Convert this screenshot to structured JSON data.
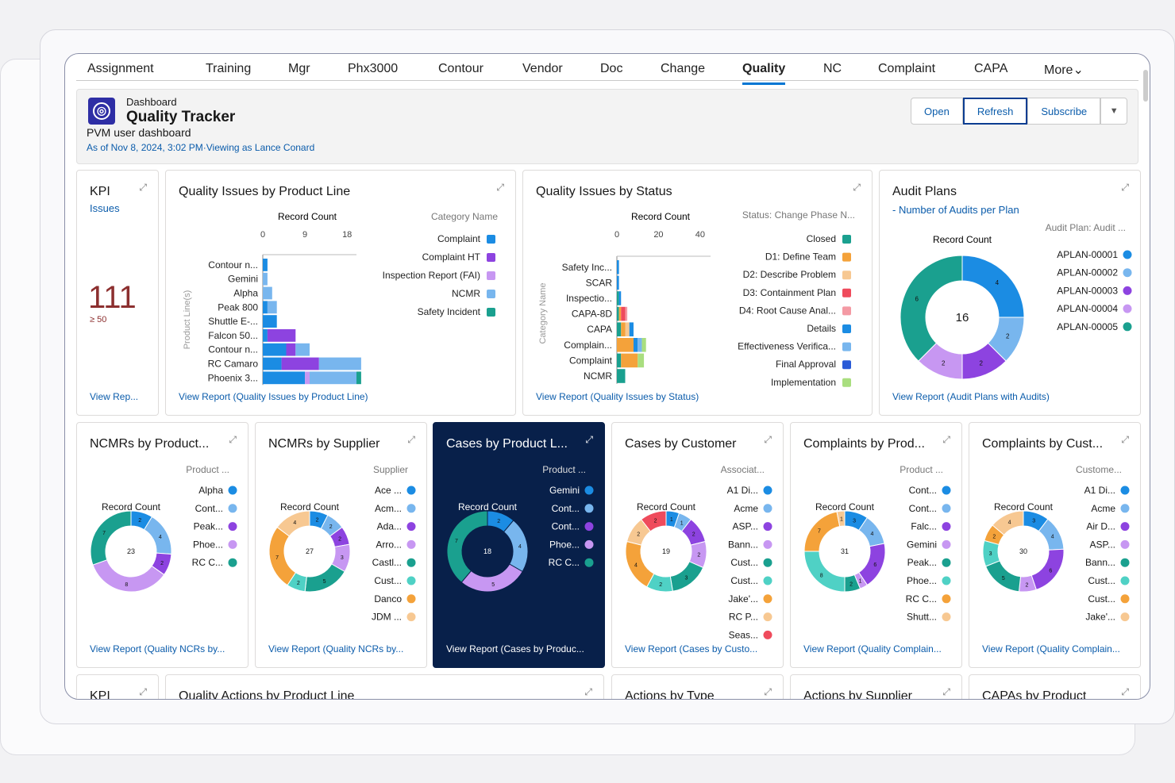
{
  "tabs": [
    "Assignment",
    "Training",
    "Mgr",
    "Phx3000",
    "Contour",
    "Vendor",
    "Doc",
    "Change",
    "Quality",
    "NC",
    "Complaint",
    "CAPA",
    "More"
  ],
  "active_tab": "Quality",
  "header": {
    "subtitle": "Dashboard",
    "title": "Quality Tracker",
    "description": "PVM user dashboard",
    "as_of": "As of Nov 8, 2024, 3:02 PM·Viewing as Lance Conard"
  },
  "buttons": {
    "open": "Open",
    "refresh": "Refresh",
    "subscribe": "Subscribe"
  },
  "kpi": {
    "title": "KPI",
    "subtitle": "Issues",
    "value": "111",
    "target": "≥ 50",
    "link": "View Rep..."
  },
  "qi_product": {
    "title": "Quality Issues by Product Line",
    "link": "View Report (Quality Issues by Product Line)",
    "xlabel": "Record Count",
    "ylabel": "Product Line(s)",
    "legend_title": "Category Name"
  },
  "qi_status": {
    "title": "Quality Issues by Status",
    "link": "View Report (Quality Issues by Status)",
    "xlabel": "Record Count",
    "ylabel": "Category Name",
    "legend_title": "Status: Change Phase N..."
  },
  "audit": {
    "title": "Audit Plans",
    "subtitle": "- Number of Audits per Plan",
    "link": "View Report (Audit Plans with Audits)",
    "count_label": "Record Count",
    "legend_title": "Audit Plan: Audit ..."
  },
  "donuts": [
    {
      "title": "NCMRs by Product...",
      "link": "View Report (Quality NCRs by...",
      "legend_title": "Product ...",
      "count_label": "Record Count"
    },
    {
      "title": "NCMRs by Supplier",
      "link": "View Report (Quality NCRs by...",
      "legend_title": "Supplier",
      "count_label": "Record Count"
    },
    {
      "title": "Cases by Product L...",
      "link": "View Report (Cases by Produc...",
      "legend_title": "Product ...",
      "count_label": "Record Count"
    },
    {
      "title": "Cases by Customer",
      "link": "View Report (Cases by Custo...",
      "legend_title": "Associat...",
      "count_label": "Record Count"
    },
    {
      "title": "Complaints by Prod...",
      "link": "View Report (Quality Complain...",
      "legend_title": "Product ...",
      "count_label": "Record Count"
    },
    {
      "title": "Complaints by Cust...",
      "link": "View Report (Quality Complain...",
      "legend_title": "Custome...",
      "count_label": "Record Count"
    }
  ],
  "row3": [
    {
      "title": "KPI"
    },
    {
      "title": "Quality Actions by Product Line"
    },
    {
      "title": "Actions by Type"
    },
    {
      "title": "Actions by Supplier"
    },
    {
      "title": "CAPAs by Product"
    }
  ],
  "chart_data": [
    {
      "type": "bar",
      "title": "Quality Issues by Product Line",
      "xlabel": "Record Count",
      "ylabel": "Product Line(s)",
      "xlim": [
        0,
        20
      ],
      "ticks": [
        "0",
        "9",
        "18"
      ],
      "categories": [
        "Contour n...",
        "Gemini",
        "Alpha",
        "Peak 800",
        "Shuttle E-...",
        "Falcon 50...",
        "Contour n...",
        "RC Camaro",
        "Phoenix 3..."
      ],
      "series": [
        {
          "name": "Complaint",
          "color": "#1b8ce3",
          "values": [
            1,
            0,
            0,
            1,
            3,
            1,
            5,
            4,
            9
          ]
        },
        {
          "name": "Complaint HT",
          "color": "#8d43e0",
          "values": [
            0,
            0,
            0,
            0,
            0,
            6,
            2,
            8,
            0
          ]
        },
        {
          "name": "Inspection Report (FAI)",
          "color": "#c797f2",
          "values": [
            0,
            0,
            0,
            0,
            0,
            0,
            0,
            0,
            1
          ]
        },
        {
          "name": "NCMR",
          "color": "#78b6ee",
          "values": [
            0,
            1,
            2,
            2,
            0,
            0,
            3,
            9,
            10
          ]
        },
        {
          "name": "Safety Incident",
          "color": "#1aa08f",
          "values": [
            0,
            0,
            0,
            0,
            0,
            0,
            0,
            0,
            1
          ]
        }
      ]
    },
    {
      "type": "bar",
      "title": "Quality Issues by Status",
      "xlabel": "Record Count",
      "ylabel": "Category Name",
      "xlim": [
        0,
        45
      ],
      "ticks": [
        "0",
        "20",
        "40"
      ],
      "categories": [
        "Safety Inc...",
        "SCAR",
        "Inspectio...",
        "CAPA-8D",
        "CAPA",
        "Complain...",
        "Complaint",
        "NCMR"
      ],
      "series": [
        {
          "name": "Closed",
          "color": "#1aa08f",
          "values": [
            0,
            0,
            1,
            1,
            2,
            0,
            2,
            4
          ]
        },
        {
          "name": "D1: Define Team",
          "color": "#f4a23a",
          "values": [
            0,
            0,
            0,
            1,
            2,
            8,
            8,
            0
          ]
        },
        {
          "name": "D2: Describe Problem",
          "color": "#f7c892",
          "values": [
            0,
            0,
            0,
            0,
            2,
            0,
            0,
            0
          ]
        },
        {
          "name": "D3: Containment Plan",
          "color": "#ef4b5c",
          "values": [
            0,
            0,
            0,
            2,
            0,
            0,
            0,
            0
          ]
        },
        {
          "name": "D4: Root Cause Anal...",
          "color": "#f49aa4",
          "values": [
            0,
            0,
            0,
            1,
            0,
            0,
            0,
            0
          ]
        },
        {
          "name": "Details",
          "color": "#1b8ce3",
          "values": [
            1,
            1,
            1,
            0,
            2,
            2,
            0,
            0
          ]
        },
        {
          "name": "Effectiveness Verifica...",
          "color": "#78b6ee",
          "values": [
            0,
            0,
            0,
            0,
            0,
            2,
            0,
            0
          ]
        },
        {
          "name": "Final Approval",
          "color": "#2a5bd7",
          "values": [
            0,
            0,
            0,
            0,
            0,
            0,
            0,
            0
          ]
        },
        {
          "name": "Implementation",
          "color": "#a9de7f",
          "values": [
            0,
            0,
            0,
            0,
            0,
            2,
            3,
            0
          ]
        }
      ]
    },
    {
      "type": "pie",
      "title": "Audit Plans",
      "total": "16",
      "labels": [
        "APLAN-00001",
        "APLAN-00002",
        "APLAN-00003",
        "APLAN-00004",
        "APLAN-00005"
      ],
      "colors": [
        "#1b8ce3",
        "#78b6ee",
        "#8d43e0",
        "#c797f2",
        "#1aa08f"
      ],
      "values": [
        4,
        2,
        2,
        2,
        6
      ]
    },
    {
      "type": "pie",
      "title": "NCMRs by Product...",
      "total": "23",
      "labels": [
        "Alpha",
        "Cont...",
        "Peak...",
        "Phoe...",
        "RC C..."
      ],
      "colors": [
        "#1b8ce3",
        "#78b6ee",
        "#8d43e0",
        "#c797f2",
        "#1aa08f"
      ],
      "values": [
        2,
        4,
        2,
        8,
        7
      ]
    },
    {
      "type": "pie",
      "title": "NCMRs by Supplier",
      "total": "27",
      "labels": [
        "Ace ...",
        "Acm...",
        "Ada...",
        "Arro...",
        "Castl...",
        "Cust...",
        "Danco",
        "JDM ..."
      ],
      "colors": [
        "#1b8ce3",
        "#78b6ee",
        "#8d43e0",
        "#c797f2",
        "#1aa08f",
        "#4fd1c5",
        "#f4a23a",
        "#f7c892"
      ],
      "values": [
        2,
        2,
        2,
        3,
        5,
        2,
        7,
        4
      ]
    },
    {
      "type": "pie",
      "title": "Cases by Product L...",
      "total": "18",
      "labels": [
        "Gemini",
        "Cont...",
        "Cont...",
        "Phoe...",
        "RC C..."
      ],
      "colors": [
        "#1b8ce3",
        "#78b6ee",
        "#8d43e0",
        "#c797f2",
        "#1aa08f"
      ],
      "values": [
        2,
        4,
        0,
        5,
        7
      ]
    },
    {
      "type": "pie",
      "title": "Cases by Customer",
      "total": "19",
      "labels": [
        "A1 Di...",
        "Acme",
        "ASP...",
        "Bann...",
        "Cust...",
        "Cust...",
        "Jake'...",
        "RC P...",
        "Seas..."
      ],
      "colors": [
        "#1b8ce3",
        "#78b6ee",
        "#8d43e0",
        "#c797f2",
        "#1aa08f",
        "#4fd1c5",
        "#f4a23a",
        "#f7c892",
        "#ef4b5c"
      ],
      "values": [
        1,
        1,
        2,
        2,
        3,
        2,
        4,
        2,
        2
      ]
    },
    {
      "type": "pie",
      "title": "Complaints by Prod...",
      "total": "31",
      "labels": [
        "Cont...",
        "Cont...",
        "Falc...",
        "Gemini",
        "Peak...",
        "Phoe...",
        "RC C...",
        "Shutt..."
      ],
      "colors": [
        "#1b8ce3",
        "#78b6ee",
        "#8d43e0",
        "#c797f2",
        "#1aa08f",
        "#4fd1c5",
        "#f4a23a",
        "#f7c892"
      ],
      "values": [
        3,
        4,
        6,
        1,
        2,
        8,
        7,
        1
      ]
    },
    {
      "type": "pie",
      "title": "Complaints by Cust...",
      "total": "30",
      "labels": [
        "A1 Di...",
        "Acme",
        "Air D...",
        "ASP...",
        "Bann...",
        "Cust...",
        "Cust...",
        "Jake'..."
      ],
      "colors": [
        "#1b8ce3",
        "#78b6ee",
        "#8d43e0",
        "#c797f2",
        "#1aa08f",
        "#4fd1c5",
        "#f4a23a",
        "#f7c892"
      ],
      "values": [
        3,
        4,
        6,
        2,
        5,
        3,
        2,
        4
      ]
    }
  ]
}
